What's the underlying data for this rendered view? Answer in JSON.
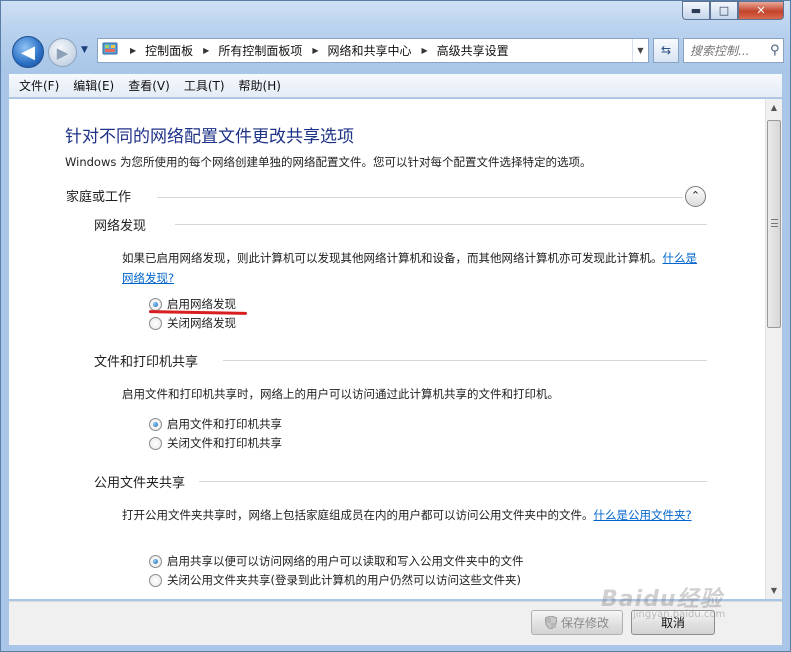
{
  "window": {
    "caption_buttons": {
      "minimize": "▬",
      "maximize": "□",
      "close": "✕"
    }
  },
  "nav": {
    "back_glyph": "◀",
    "forward_glyph": "▶",
    "history_glyph": "▼",
    "breadcrumbs": [
      "控制面板",
      "所有控制面板项",
      "网络和共享中心",
      "高级共享设置"
    ],
    "search_placeholder": "搜索控制...",
    "icons": {
      "address": "control-panel-icon",
      "refresh": "refresh-icon",
      "search": "search-icon"
    }
  },
  "menu": [
    "文件(F)",
    "编辑(E)",
    "查看(V)",
    "工具(T)",
    "帮助(H)"
  ],
  "main": {
    "title": "针对不同的网络配置文件更改共享选项",
    "description": "Windows 为您所使用的每个网络创建单独的网络配置文件。您可以针对每个配置文件选择特定的选项。",
    "profile": {
      "label": "家庭或工作",
      "collapse_glyph": "⌃"
    },
    "sections": [
      {
        "title": "网络发现",
        "text": "如果已启用网络发现，则此计算机可以发现其他网络计算机和设备，而其他网络计算机亦可发现此计算机。",
        "link": "什么是网络发现?",
        "options": [
          {
            "label": "启用网络发现",
            "checked": true
          },
          {
            "label": "关闭网络发现",
            "checked": false
          }
        ]
      },
      {
        "title": "文件和打印机共享",
        "text": "启用文件和打印机共享时，网络上的用户可以访问通过此计算机共享的文件和打印机。",
        "link": "",
        "options": [
          {
            "label": "启用文件和打印机共享",
            "checked": true
          },
          {
            "label": "关闭文件和打印机共享",
            "checked": false
          }
        ]
      },
      {
        "title": "公用文件夹共享",
        "text": "打开公用文件夹共享时，网络上包括家庭组成员在内的用户都可以访问公用文件夹中的文件。",
        "link": "什么是公用文件夹?",
        "options": [
          {
            "label": "启用共享以便可以访问网络的用户可以读取和写入公用文件夹中的文件",
            "checked": true
          },
          {
            "label": "关闭公用文件夹共享(登录到此计算机的用户仍然可以访问这些文件夹)",
            "checked": false
          }
        ]
      }
    ]
  },
  "footer": {
    "save_label": "保存修改",
    "cancel_label": "取消"
  },
  "watermark": {
    "main": "Baidu经验",
    "sub": "jingyan.baidu.com"
  },
  "colors": {
    "title": "#1e3287",
    "link": "#0066cc",
    "annotation_red": "#d81e1e"
  }
}
